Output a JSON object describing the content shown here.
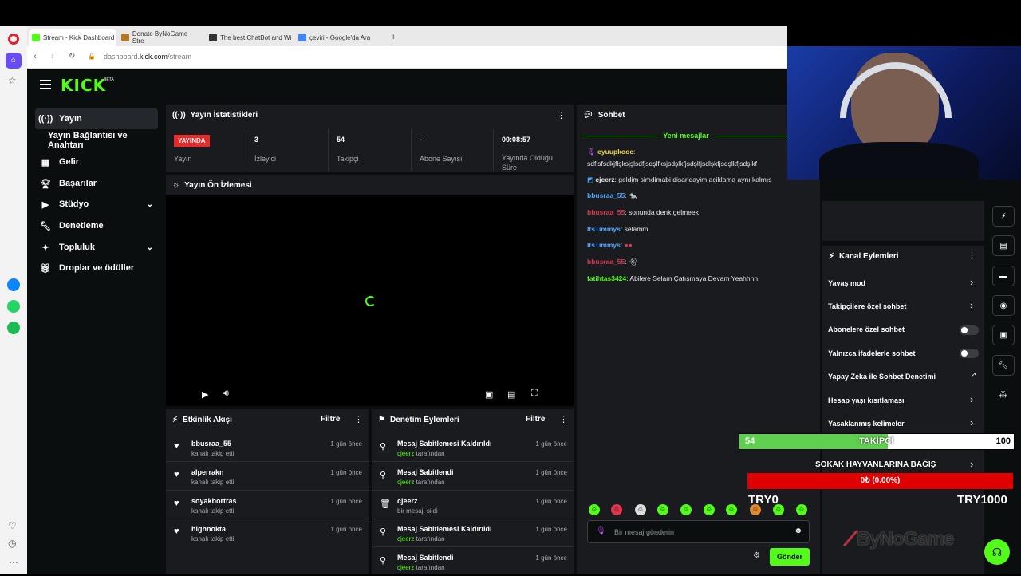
{
  "browser": {
    "tabs": [
      {
        "label": "Stream - Kick Dashboard",
        "color": "#53fc18"
      },
      {
        "label": "Donate ByNoGame - Stre",
        "color": "#b07a2a"
      },
      {
        "label": "The best ChatBot and Wi",
        "color": "#333333"
      },
      {
        "label": "çeviri - Google'da Ara",
        "color": "#4285f4"
      }
    ],
    "new_tab": "+",
    "url_prefix": "dashboard.",
    "url_domain": "kick.com",
    "url_path": "/stream"
  },
  "kick": {
    "logo": "KICK",
    "logo_badge": "BETA",
    "accent": "#53fc18"
  },
  "sidebar": {
    "items": [
      {
        "label": "Yayın",
        "icon": "broadcast-icon"
      },
      {
        "label": "Yayın Bağlantısı ve Anahtarı",
        "icon": ""
      },
      {
        "label": "Gelir",
        "icon": "revenue-icon"
      },
      {
        "label": "Başarılar",
        "icon": "trophy-icon"
      },
      {
        "label": "Stüdyo",
        "icon": "studio-icon"
      },
      {
        "label": "Denetleme",
        "icon": "wrench-icon"
      },
      {
        "label": "Topluluk",
        "icon": "community-icon"
      },
      {
        "label": "Droplar ve ödüller",
        "icon": "gift-icon"
      }
    ]
  },
  "stats": {
    "title": "Yayın İstatistikleri",
    "live_badge": "YAYINDA",
    "live_label": "Yayın",
    "viewers_value": "3",
    "viewers_label": "İzleyici",
    "followers_value": "54",
    "followers_label": "Takipçi",
    "subs_value": "-",
    "subs_label": "Abone Sayısı",
    "uptime_value": "00:08:57",
    "uptime_label": "Yayında Olduğu Süre"
  },
  "preview": {
    "title": "Yayın Ön İzlemesi"
  },
  "activity": {
    "title": "Etkinlik Akışı",
    "filter": "Filtre",
    "rows": [
      {
        "name": "bbusraa_55",
        "sub": "kanalı takip etti",
        "time": "1 gün önce"
      },
      {
        "name": "alperrakn",
        "sub": "kanalı takip etti",
        "time": "1 gün önce"
      },
      {
        "name": "soyakbortras",
        "sub": "kanalı takip etti",
        "time": "1 gün önce"
      },
      {
        "name": "highnokta",
        "sub": "kanalı takip etti",
        "time": "1 gün önce"
      }
    ]
  },
  "moderation": {
    "title": "Denetim Eylemleri",
    "filter": "Filtre",
    "rows": [
      {
        "name": "Mesaj Sabitlemesi Kaldırıldı",
        "actor": "cjeerz",
        "suffix": "tarafından",
        "time": "1 gün önce"
      },
      {
        "name": "Mesaj Sabitlendi",
        "actor": "cjeerz",
        "suffix": "tarafından",
        "time": "1 gün önce"
      },
      {
        "name": "cjeerz",
        "actor": "",
        "suffix": "bir mesajı sildi",
        "time": "1 gün önce"
      },
      {
        "name": "Mesaj Sabitlemesi Kaldırıldı",
        "actor": "cjeerz",
        "suffix": "tarafından",
        "time": "1 gün önce"
      },
      {
        "name": "Mesaj Sabitlendi",
        "actor": "cjeerz",
        "suffix": "tarafından",
        "time": "1 gün önce"
      }
    ]
  },
  "chat": {
    "title": "Sohbet",
    "new_messages": "Yeni mesajlar",
    "messages": [
      {
        "user": "eyuupkooc",
        "color": "#f2d54a",
        "text": ""
      },
      {
        "user": "",
        "color": "#ffffff",
        "text": "sdfisfsdkjflşksjşlsdfjsdşlfksjsdşlkfjsdşlfjsdlşkfjsdşlkfjsdşlkf"
      },
      {
        "user": "cjeerz",
        "color": "#ffffff",
        "text": "geldim simdimabi disaridayim aciklama aynı kalmıs"
      },
      {
        "user": "bbusraa_55",
        "color": "#4ea4ff",
        "text": ""
      },
      {
        "user": "bbusraa_55",
        "color": "#e0344f",
        "text": "sonunda denk gelmeek"
      },
      {
        "user": "ItsTimmys",
        "color": "#4ea4ff",
        "text": "selamm"
      },
      {
        "user": "ItsTimmys",
        "color": "#4ea4ff",
        "text": ""
      },
      {
        "user": "bbusraa_55",
        "color": "#e0344f",
        "text": ""
      },
      {
        "user": "fatihtas3424",
        "color": "#53fc18",
        "text": "Abilere Selam Çatışmaya Devam Yeahhhh"
      }
    ],
    "input_placeholder": "Bir mesaj gönderin",
    "send": "Gönder"
  },
  "channel_actions": {
    "title": "Kanal Eylemleri",
    "items": [
      {
        "label": "Yavaş mod",
        "control": "chevron"
      },
      {
        "label": "Takipçilere özel sohbet",
        "control": "chevron"
      },
      {
        "label": "Abonelere özel sohbet",
        "control": "toggle"
      },
      {
        "label": "Yalnızca ifadelerle sohbet",
        "control": "toggle"
      },
      {
        "label": "Yapay Zeka ile Sohbet Denetimi",
        "control": "external"
      },
      {
        "label": "Hesap yaşı kısıtlaması",
        "control": "chevron"
      },
      {
        "label": "Yasaklanmış kelimeler",
        "control": "chevron"
      }
    ]
  },
  "overlay": {
    "follower_current": "54",
    "follower_label": "TAKİPÇİ",
    "follower_goal": "100",
    "follower_fraction": 0.54,
    "donation_title": "SOKAK HAYVANLARINA BAĞIŞ",
    "donation_amount": "0₺ (0.00%)",
    "donation_min": "TRY0",
    "donation_max": "TRY1000",
    "brand": "ByNoGame"
  }
}
